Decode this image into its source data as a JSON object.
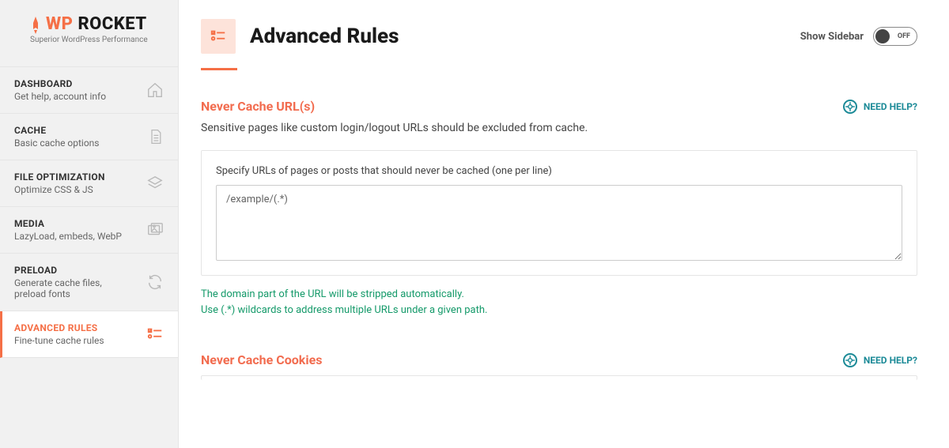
{
  "logo": {
    "wp": "WP",
    "rocket": "ROCKET",
    "tagline": "Superior WordPress Performance"
  },
  "nav": {
    "items": [
      {
        "title": "DASHBOARD",
        "sub": "Get help, account info"
      },
      {
        "title": "CACHE",
        "sub": "Basic cache options"
      },
      {
        "title": "FILE OPTIMIZATION",
        "sub": "Optimize CSS & JS"
      },
      {
        "title": "MEDIA",
        "sub": "LazyLoad, embeds, WebP"
      },
      {
        "title": "PRELOAD",
        "sub": "Generate cache files, preload fonts"
      },
      {
        "title": "ADVANCED RULES",
        "sub": "Fine-tune cache rules"
      }
    ]
  },
  "header": {
    "title": "Advanced Rules",
    "show_sidebar_label": "Show Sidebar",
    "toggle_state": "OFF"
  },
  "sections": {
    "never_cache_url": {
      "title": "Never Cache URL(s)",
      "need_help": "NEED HELP?",
      "desc": "Sensitive pages like custom login/logout URLs should be excluded from cache.",
      "field_label": "Specify URLs of pages or posts that should never be cached (one per line)",
      "placeholder": "/example/(.*)",
      "tip1": "The domain part of the URL will be stripped automatically.",
      "tip2": "Use (.*) wildcards to address multiple URLs under a given path."
    },
    "never_cache_cookies": {
      "title": "Never Cache Cookies",
      "need_help": "NEED HELP?"
    }
  }
}
